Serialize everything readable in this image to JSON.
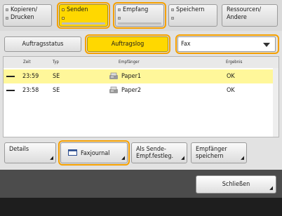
{
  "function_tabs": [
    {
      "line1": "Kopieren/",
      "line2": "Drucken"
    },
    {
      "line1": "Senden",
      "line2": ""
    },
    {
      "line1": "Empfang",
      "line2": ""
    },
    {
      "line1": "Speichern",
      "line2": ""
    },
    {
      "line1": "Ressourcen/",
      "line2": "Andere"
    }
  ],
  "sub_tabs": {
    "status": "Auftragsstatus",
    "log": "Auftragslog"
  },
  "filter": {
    "selected": "Fax"
  },
  "table": {
    "headers": {
      "time": "Zeit",
      "type": "Typ",
      "recipient": "Empfänger",
      "result": "Ergebnis"
    },
    "rows": [
      {
        "time": "23:59",
        "type": "SE",
        "recipient": "Paper1",
        "result": "OK",
        "selected": true
      },
      {
        "time": "23:58",
        "type": "SE",
        "recipient": "Paper2",
        "result": "OK",
        "selected": false
      }
    ]
  },
  "buttons": {
    "details": "Details",
    "fax_journal": "Faxjournal",
    "as_dest_line1": "Als Sende-",
    "as_dest_line2": "Empf.festleg.",
    "reg_dest_line1": "Empfänger",
    "reg_dest_line2": "speichern",
    "close": "Schließen"
  },
  "colors": {
    "active_tab": "#ffd800",
    "highlight_outline": "#f5a000",
    "selected_row": "#fff79a"
  }
}
